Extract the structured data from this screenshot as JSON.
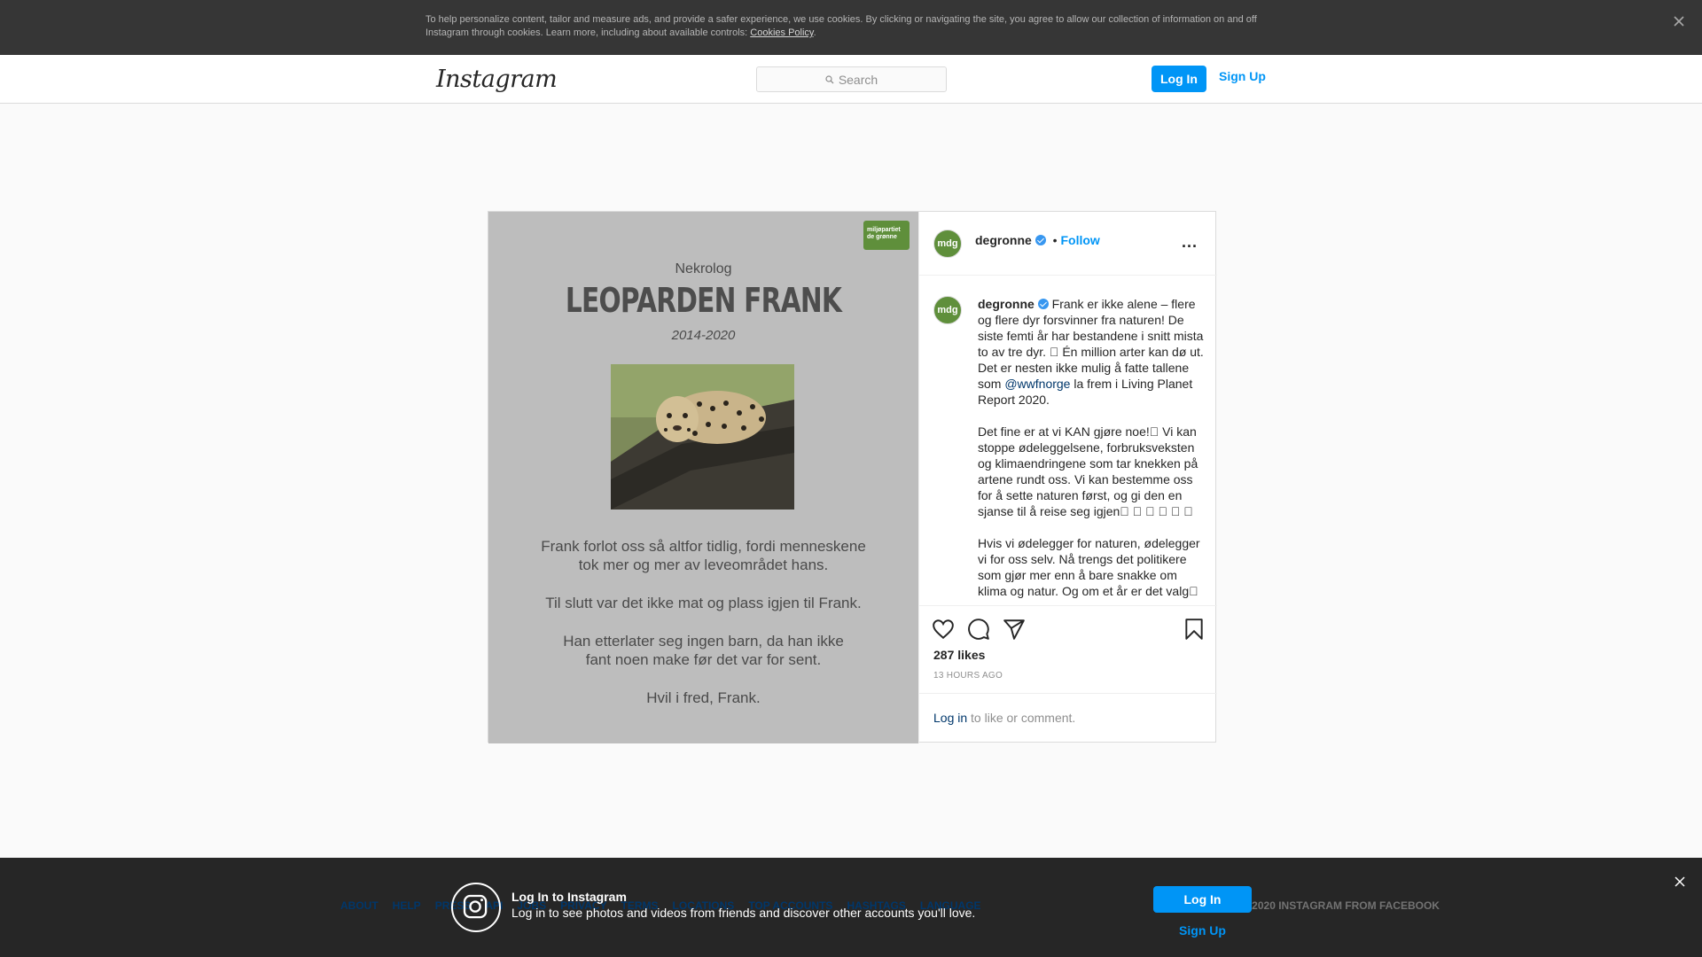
{
  "cookie_banner": {
    "text": "To help personalize content, tailor and measure ads, and provide a safer experience, we use cookies. By clicking or navigating the site, you agree to allow our collection of information on and off Instagram through cookies. Learn more, including about available controls: ",
    "link": "Cookies Policy",
    "tail": "."
  },
  "header": {
    "logo": "Instagram",
    "search_placeholder": "Search",
    "login": "Log In",
    "signup": "Sign Up"
  },
  "post": {
    "image": {
      "badge": "miljøpartiet de grønne",
      "kicker": "Nekrolog",
      "title": "LEOPARDEN FRANK",
      "years": "2014-2020",
      "lines": [
        "Frank forlot oss så altfor tidlig, fordi menneskene",
        "tok mer og mer av leveområdet hans.",
        "Til slutt var det ikke mat og plass igjen til Frank.",
        "Han etterlater seg ingen barn, da han ikke",
        "fant noen make før det var for sent.",
        "Hvil i fred, Frank."
      ]
    },
    "avatar_text": "mdg",
    "username": "degronne",
    "follow": "Follow",
    "follow_sep": "•",
    "more": "...",
    "caption": {
      "p1_a": "Frank er ikke alene – flere og flere dyr forsvinner fra naturen! De siste femti år har bestandene i snitt mista to av tre dyr. \u0000  Én million arter kan dø ut. Det er nesten ikke mulig å fatte tallene som ",
      "mention": "@wwfnorge",
      "p1_b": " la frem i Living Planet Report 2020.",
      "p2": "Det fine er at vi KAN gjøre noe!\u0000  Vi kan stoppe ødeleggelsene, forbruksveksten og klimaendringene som tar knekken på artene rundt oss. Vi kan bestemme oss for å sette naturen først, og gi den en sjanse til å reise seg igjen\u0000 \u0000 \u0000 \u0000 \u0000 \u0000",
      "p3": "Hvis vi ødelegger for naturen, ødelegger vi for oss selv. Nå trengs det politikere som gjør mer enn å bare snakke om klima og natur. Og om et år er det valg\u0000"
    },
    "likes": "287 likes",
    "time": "13 HOURS AGO",
    "login_link": "Log in",
    "login_tail": " to like or comment."
  },
  "footer": {
    "links": [
      "ABOUT",
      "HELP",
      "PRESS",
      "API",
      "JOBS",
      "PRIVACY",
      "TERMS",
      "LOCATIONS",
      "TOP ACCOUNTS",
      "HASHTAGS",
      "LANGUAGE"
    ],
    "right": "© 2020 INSTAGRAM FROM FACEBOOK"
  },
  "login_bar": {
    "title": "Log In to Instagram",
    "subtitle": "Log in to see photos and videos from friends and discover other accounts you'll love.",
    "login": "Log In",
    "signup": "Sign Up"
  }
}
